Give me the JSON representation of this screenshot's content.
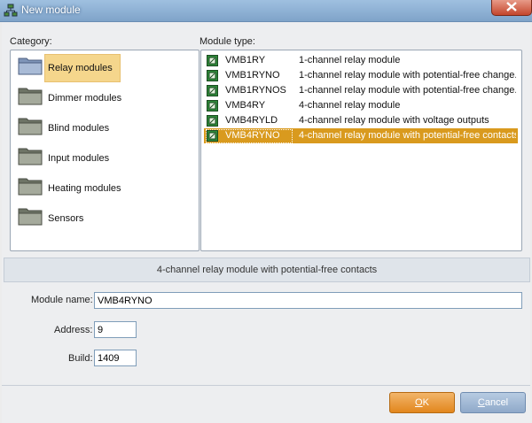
{
  "window": {
    "title": "New module",
    "icons": {
      "app": "network-icon",
      "close": "close-icon"
    }
  },
  "category": {
    "label": "Category:",
    "items": [
      {
        "label": "Relay modules",
        "icon": "folder-icon",
        "selected": true
      },
      {
        "label": "Dimmer modules",
        "icon": "folder-icon"
      },
      {
        "label": "Blind modules",
        "icon": "folder-icon"
      },
      {
        "label": "Input modules",
        "icon": "folder-icon"
      },
      {
        "label": "Heating modules",
        "icon": "folder-icon"
      },
      {
        "label": "Sensors",
        "icon": "folder-icon"
      }
    ]
  },
  "module_type": {
    "label": "Module type:",
    "rows": [
      {
        "code": "VMB1RY",
        "desc": "1-channel relay module",
        "icon": "relay-module-icon"
      },
      {
        "code": "VMB1RYNO",
        "desc": "1-channel relay module with potential-free change...",
        "icon": "relay-module-icon"
      },
      {
        "code": "VMB1RYNOS",
        "desc": "1-channel relay module with potential-free change...",
        "icon": "relay-module-icon"
      },
      {
        "code": "VMB4RY",
        "desc": "4-channel relay module",
        "icon": "relay-module-icon"
      },
      {
        "code": "VMB4RYLD",
        "desc": "4-channel relay module with voltage outputs",
        "icon": "relay-module-icon"
      },
      {
        "code": "VMB4RYNO",
        "desc": "4-channel relay module with potential-free contacts",
        "icon": "relay-module-icon",
        "selected": true
      }
    ]
  },
  "description": "4-channel relay module with potential-free contacts",
  "form": {
    "module_name_label": "Module name:",
    "module_name_value": "VMB4RYNO",
    "address_label": "Address:",
    "address_value": "9",
    "build_label": "Build:",
    "build_value": "1409"
  },
  "buttons": {
    "ok_label": "OK",
    "ok_mnemonic": "O",
    "ok_rest": "K",
    "cancel_label": "Cancel",
    "cancel_mnemonic": "C",
    "cancel_rest": "ancel"
  },
  "colors": {
    "selection": "#d99a1e",
    "category_selection": "#f5d68c",
    "ok_button": "#e2861d",
    "cancel_button": "#8fa9c9"
  }
}
